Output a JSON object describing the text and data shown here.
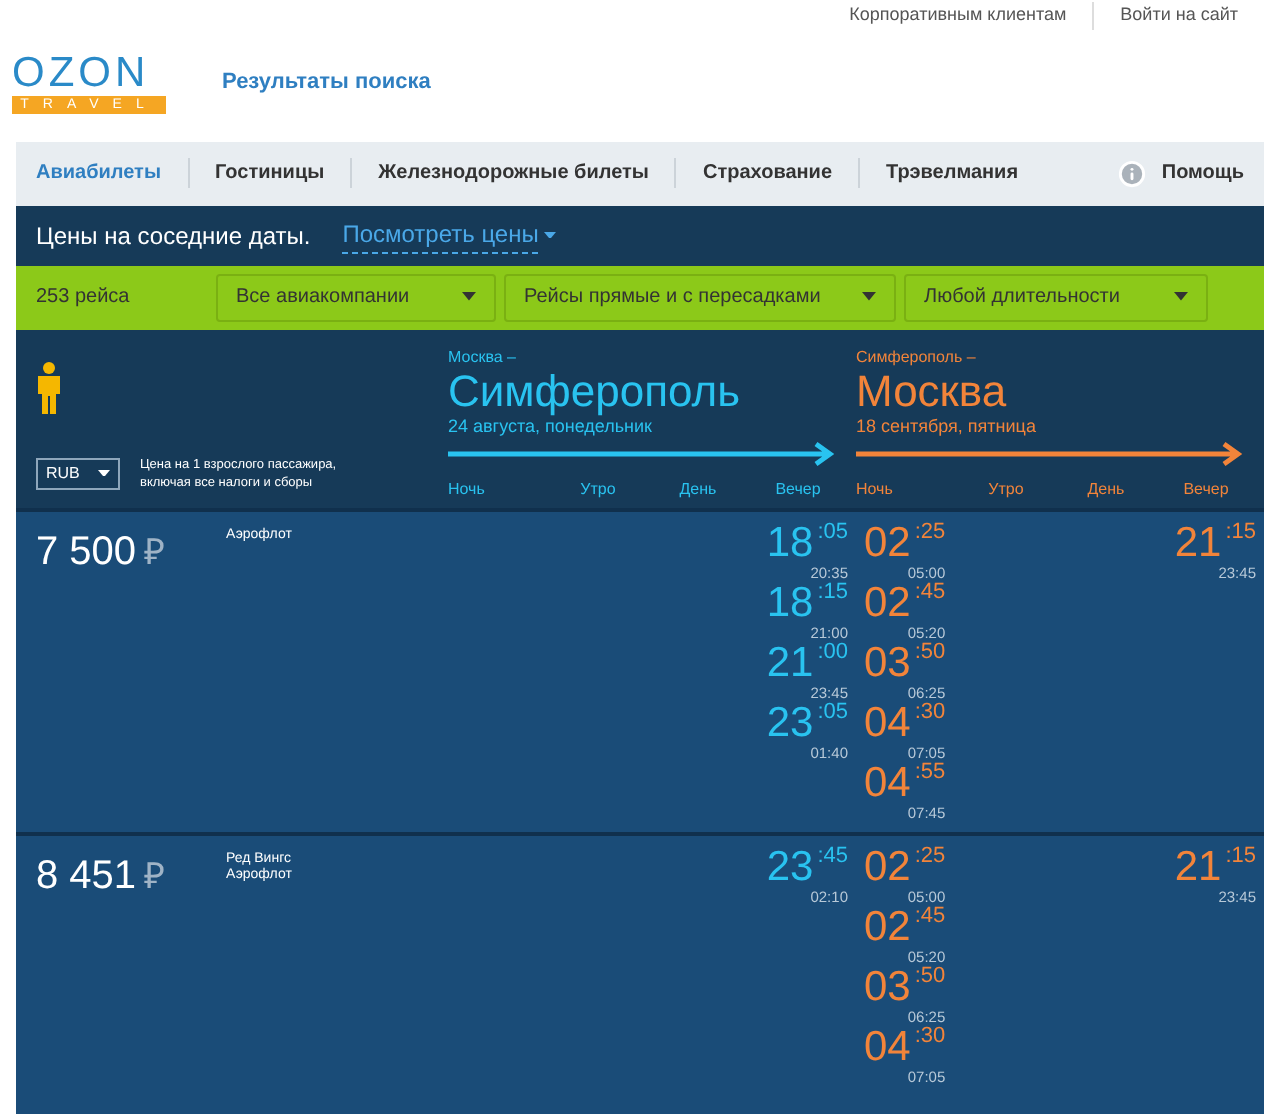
{
  "top_links": [
    "Корпоративным клиентам",
    "Войти на сайт"
  ],
  "logo": {
    "brand": "OZON",
    "sub": "TRAVEL"
  },
  "page_title": "Результаты поиска",
  "nav": [
    {
      "label": "Авиабилеты",
      "selected": true
    },
    {
      "label": "Гостиницы",
      "selected": false
    },
    {
      "label": "Железнодорожные билеты",
      "selected": false
    },
    {
      "label": "Страхование",
      "selected": false
    },
    {
      "label": "Трэвелмания",
      "selected": false
    }
  ],
  "help": "Помощь",
  "nearby": {
    "text": "Цены на соседние даты.",
    "link": "Посмотреть цены"
  },
  "filters": {
    "count": "253 рейса",
    "selects": [
      "Все авиакомпании",
      "Рейсы прямые и с пересадками",
      "Любой длительности"
    ]
  },
  "currency": "RUB",
  "price_note": "Цена на 1 взрослого пассажира, включая все налоги и сборы",
  "legs": [
    {
      "from": "Москва –",
      "to": "Симферополь",
      "date": "24 августа, понедельник",
      "color": "#29c3f0",
      "periods": [
        "Ночь",
        "Утро",
        "День",
        "Вечер"
      ]
    },
    {
      "from": "Симферополь –",
      "to": "Москва",
      "date": "18 сентября, пятница",
      "color": "#f2843a",
      "periods": [
        "Ночь",
        "Утро",
        "День",
        "Вечер"
      ]
    }
  ],
  "results": [
    {
      "price": "7 500",
      "currency_sign": "₽",
      "airlines": [
        "Аэрофлот"
      ],
      "legs": [
        [
          {
            "hour": "18",
            "minute": ":05",
            "arrival": "20:35"
          },
          {
            "hour": "18",
            "minute": ":15",
            "arrival": "21:00"
          },
          {
            "hour": "21",
            "minute": ":00",
            "arrival": "23:45"
          },
          {
            "hour": "23",
            "minute": ":05",
            "arrival": "01:40"
          }
        ],
        [
          {
            "hour": "02",
            "minute": ":25",
            "arrival": "05:00"
          },
          {
            "hour": "02",
            "minute": ":45",
            "arrival": "05:20"
          },
          {
            "hour": "03",
            "minute": ":50",
            "arrival": "06:25"
          },
          {
            "hour": "04",
            "minute": ":30",
            "arrival": "07:05"
          },
          {
            "hour": "04",
            "minute": ":55",
            "arrival": "07:45"
          },
          {
            "hour": "21",
            "minute": ":15",
            "arrival": "23:45"
          }
        ]
      ]
    },
    {
      "price": "8 451",
      "currency_sign": "₽",
      "airlines": [
        "Ред Вингс",
        "Аэрофлот"
      ],
      "legs": [
        [
          {
            "hour": "23",
            "minute": ":45",
            "arrival": "02:10"
          }
        ],
        [
          {
            "hour": "02",
            "minute": ":25",
            "arrival": "05:00"
          },
          {
            "hour": "02",
            "minute": ":45",
            "arrival": "05:20"
          },
          {
            "hour": "03",
            "minute": ":50",
            "arrival": "06:25"
          },
          {
            "hour": "04",
            "minute": ":30",
            "arrival": "07:05"
          },
          {
            "hour": "21",
            "minute": ":15",
            "arrival": "23:45"
          }
        ]
      ]
    }
  ]
}
